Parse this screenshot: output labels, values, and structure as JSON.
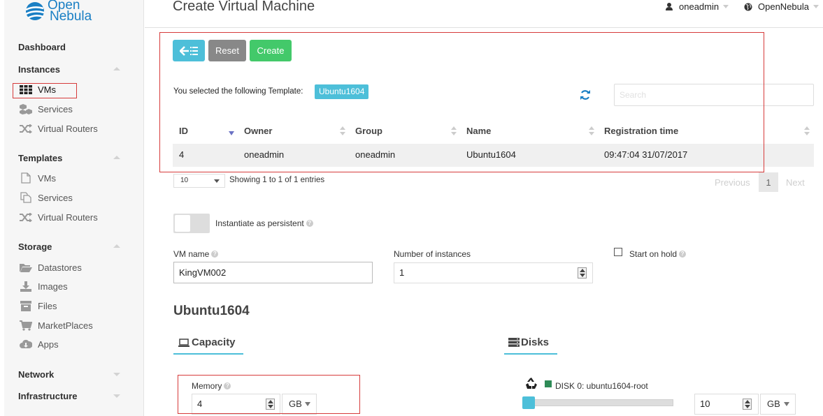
{
  "brand": {
    "line1": "Open",
    "line2": "Nebula"
  },
  "colors": {
    "accent": "#4dbfd9",
    "create": "#43c96a",
    "reset": "#888888",
    "highlight": "#d63b3b",
    "logo": "#1a7fc4"
  },
  "sidebar": {
    "dashboard": "Dashboard",
    "instances": {
      "label": "Instances",
      "items": [
        {
          "label": "VMs",
          "icon": "grid-icon"
        },
        {
          "label": "Services",
          "icon": "cubes-icon"
        },
        {
          "label": "Virtual Routers",
          "icon": "random-icon"
        }
      ]
    },
    "templates": {
      "label": "Templates",
      "items": [
        {
          "label": "VMs",
          "icon": "file-icon"
        },
        {
          "label": "Services",
          "icon": "files-icon"
        },
        {
          "label": "Virtual Routers",
          "icon": "random-icon"
        }
      ]
    },
    "storage": {
      "label": "Storage",
      "items": [
        {
          "label": "Datastores",
          "icon": "folder-open-icon"
        },
        {
          "label": "Images",
          "icon": "download-icon"
        },
        {
          "label": "Files",
          "icon": "archive-icon"
        },
        {
          "label": "MarketPlaces",
          "icon": "cart-icon"
        },
        {
          "label": "Apps",
          "icon": "cloud-download-icon"
        }
      ]
    },
    "network": "Network",
    "infrastructure": "Infrastructure"
  },
  "header": {
    "title": "Create Virtual Machine",
    "user": "oneadmin",
    "zone": "OpenNebula"
  },
  "toolbar": {
    "reset": "Reset",
    "create": "Create"
  },
  "template_select": {
    "selected_text": "You selected the following Template:",
    "selected_badge": "Ubuntu1604",
    "search_placeholder": "Search"
  },
  "table": {
    "columns": [
      "ID",
      "Owner",
      "Group",
      "Name",
      "Registration time"
    ],
    "rows": [
      [
        "4",
        "oneadmin",
        "oneadmin",
        "Ubuntu1604",
        "09:47:04 31/07/2017"
      ]
    ],
    "page_size": "10",
    "info": "Showing 1 to 1 of 1 entries",
    "previous": "Previous",
    "current_page": "1",
    "next": "Next"
  },
  "form": {
    "persistent_label": "Instantiate as persistent",
    "vm_name_label": "VM name",
    "vm_name_value": "KingVM002",
    "instances_label": "Number of instances",
    "instances_value": "1",
    "hold_label": "Start on hold"
  },
  "template_section": {
    "title": "Ubuntu1604",
    "capacity_tab": "Capacity",
    "disks_tab": "Disks",
    "memory_label": "Memory",
    "memory_value": "4",
    "memory_unit": "GB",
    "disk_label": "DISK 0: ubuntu1604-root",
    "disk_size_value": "10",
    "disk_unit": "GB",
    "disk_slider_fraction": 0.0
  }
}
